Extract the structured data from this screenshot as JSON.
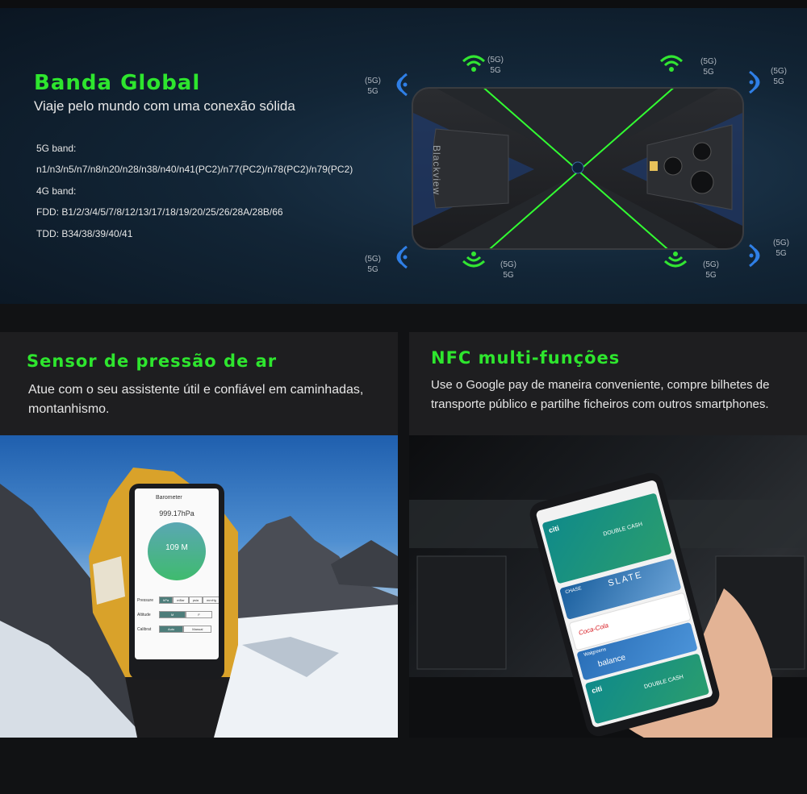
{
  "hero": {
    "title": "Banda Global",
    "subtitle": "Viaje pelo mundo com uma conexão sólida",
    "bands": [
      "5G band:",
      "n1/n3/n5/n7/n8/n20/n28/n38/n40/n41(PC2)/n77(PC2)/n78(PC2)/n79(PC2)",
      "4G band:",
      "FDD: B1/2/3/4/5/7/8/12/13/17/18/19/20/25/26/28A/28B/66",
      "TDD: B34/38/39/40/41"
    ],
    "signal_label_top": "(5G)",
    "signal_label_bottom": "5G",
    "brand_on_phone": "Blackview",
    "accent_green": "#2ee62e",
    "accent_blue": "#2f7fe6"
  },
  "sensor": {
    "title": "Sensor de pressão de ar",
    "description": "Atue com o seu assistente útil e confiável em caminhadas, montanhismo.",
    "screen": {
      "app_title": "Barometer",
      "pressure_value": "999.17hPa",
      "altitude_value": "109 M",
      "row_pressure": "Pressure",
      "row_altitude": "Altitude",
      "row_calibrat": "Calibrat",
      "pressure_units": [
        "hPa",
        "mBar",
        "psia",
        "mmHg"
      ],
      "altitude_units": [
        "M",
        "F"
      ],
      "calib_options": [
        "Auto",
        "Manual"
      ]
    }
  },
  "nfc": {
    "title": "NFC multi-funções",
    "description": "Use o Google pay de maneira conveniente, compre bilhetes de transporte público e partilhe ficheiros com outros smartphones.",
    "cards": [
      {
        "brand": "citi",
        "name": "DOUBLE CASH"
      },
      {
        "brand": "CHASE",
        "name": "SLATE"
      },
      {
        "brand": "Coca-Cola",
        "name": ""
      },
      {
        "brand": "Walgreens",
        "name": "balance"
      },
      {
        "brand": "citi",
        "name": "DOUBLE CASH"
      }
    ]
  }
}
